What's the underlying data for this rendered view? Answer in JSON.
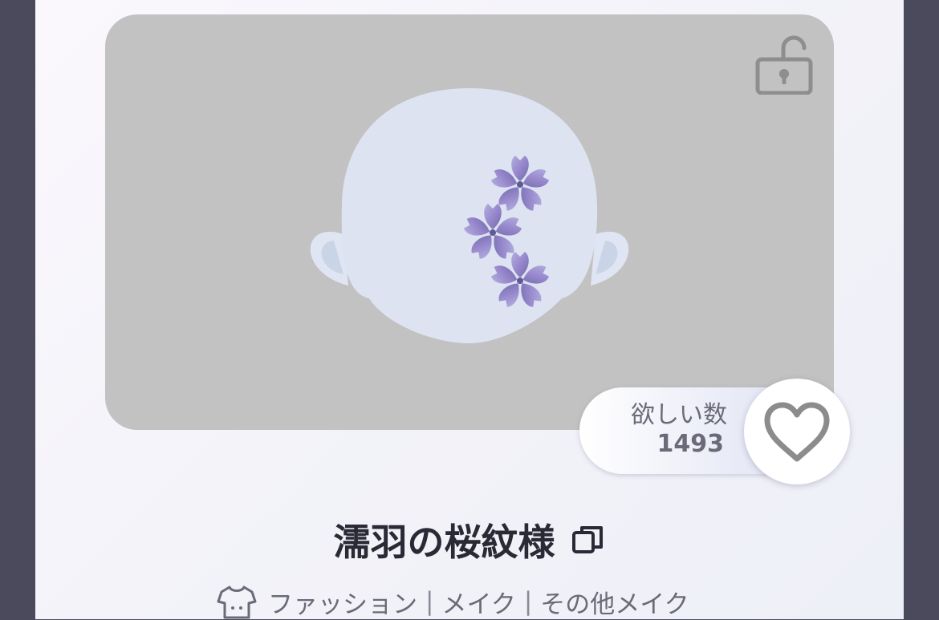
{
  "item": {
    "title": "濡羽の桜紋様",
    "locked": false
  },
  "wishlist": {
    "label": "欲しい数",
    "count": "1493"
  },
  "categories": [
    "ファッション",
    "メイク",
    "その他メイク"
  ],
  "separator": "|",
  "icons": {
    "lock": "unlocked-padlock-icon",
    "favorite": "heart-outline-icon",
    "copy": "copy-icon",
    "category": "shirt-icon"
  },
  "colors": {
    "preview_background": "#c2c2c2",
    "text_primary": "#2a2a36",
    "text_secondary": "#6a6a78",
    "sakura": "#8a7fc0"
  }
}
